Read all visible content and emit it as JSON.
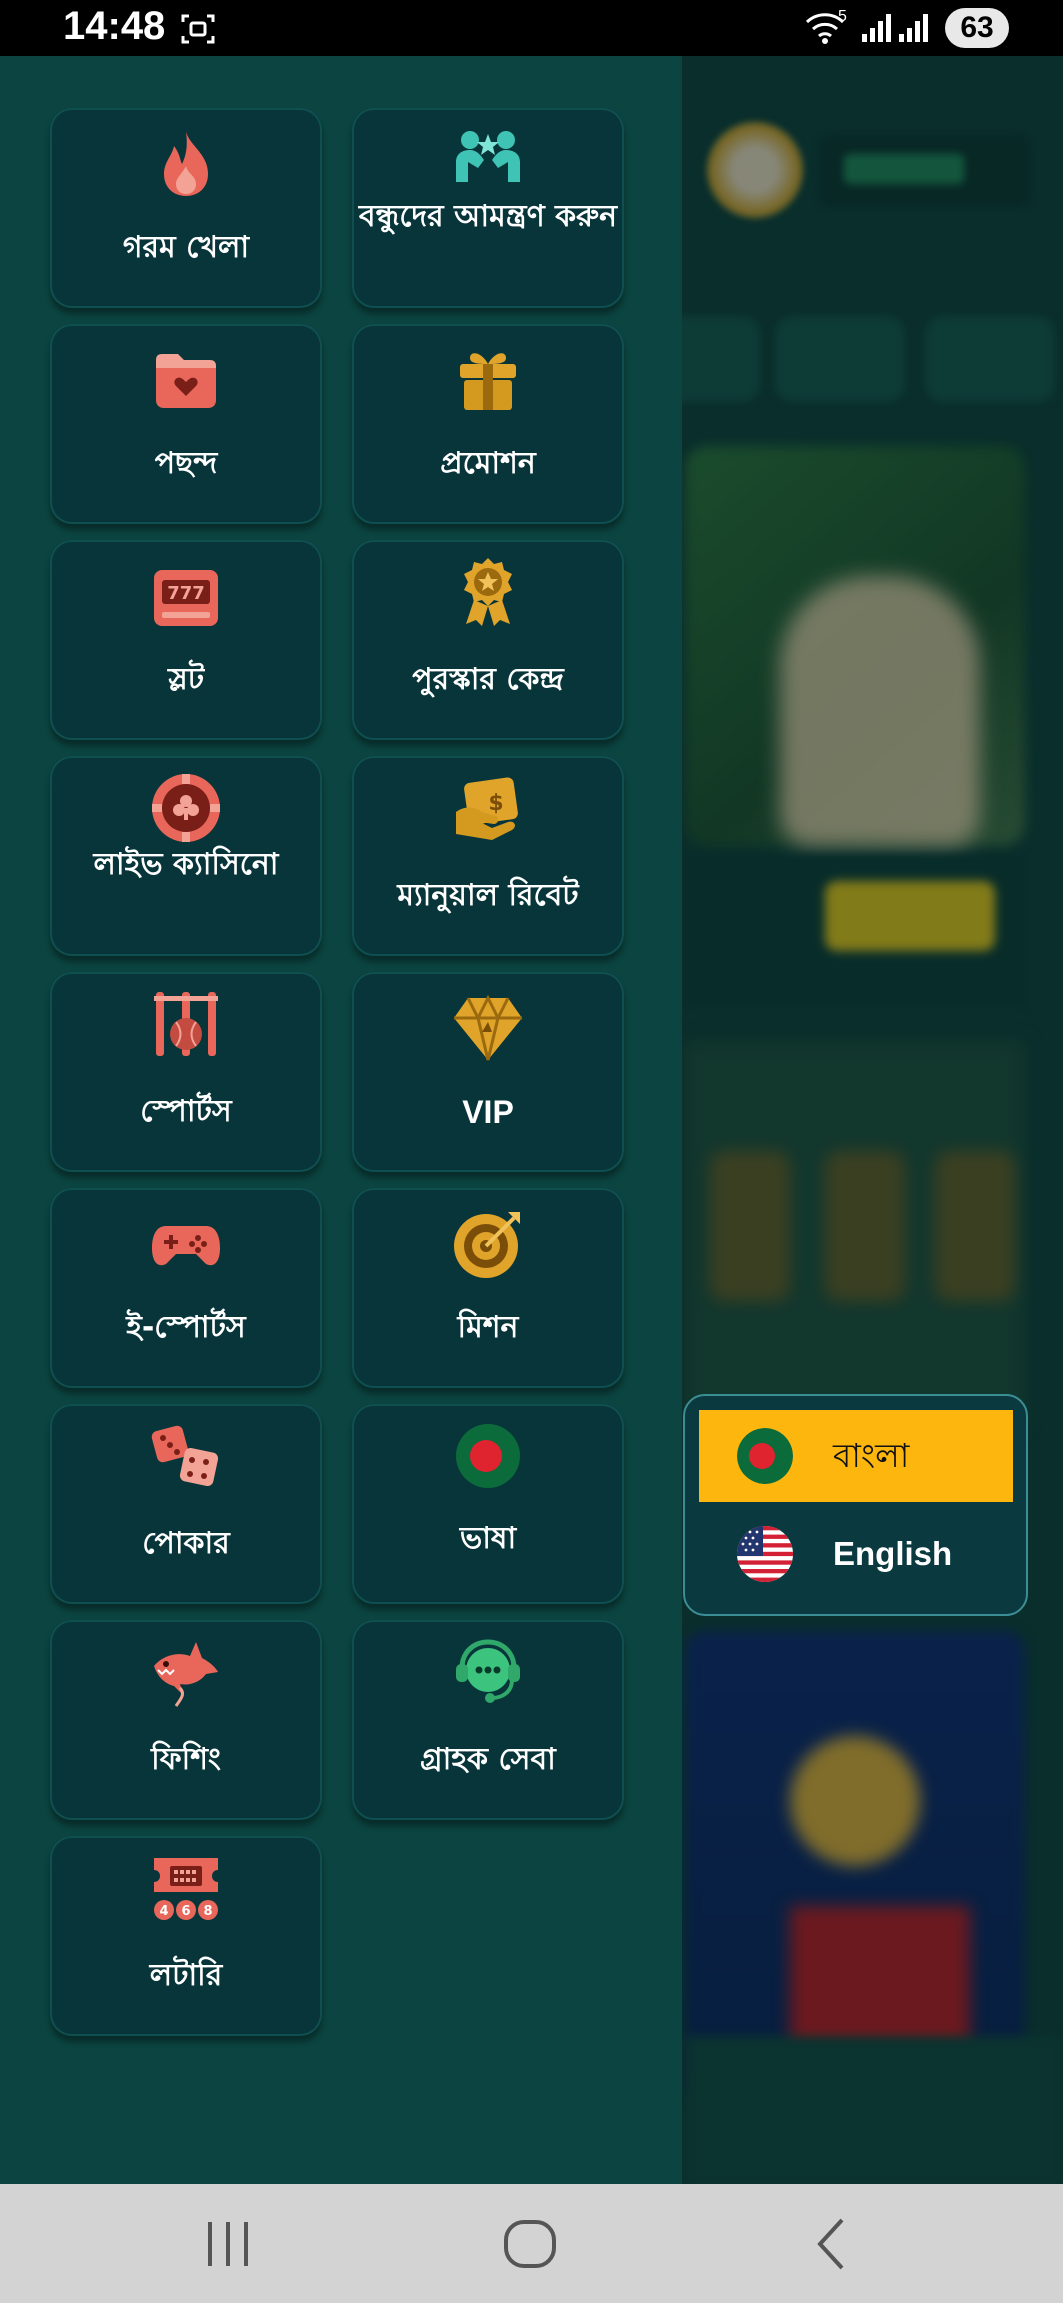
{
  "status_bar": {
    "time": "14:48",
    "wifi_label": "5",
    "battery": "63"
  },
  "menu": {
    "items": [
      {
        "label": "গরম খেলা",
        "icon": "fire-icon"
      },
      {
        "label": "বন্ধুদের আমন্ত্রণ করুন",
        "icon": "invite-friends-icon"
      },
      {
        "label": "পছন্দ",
        "icon": "favorite-folder-icon"
      },
      {
        "label": "প্রমোশন",
        "icon": "gift-icon"
      },
      {
        "label": "স্লট",
        "icon": "slot-machine-icon"
      },
      {
        "label": "পুরস্কার কেন্দ্র",
        "icon": "medal-icon"
      },
      {
        "label": "লাইভ ক্যাসিনো",
        "icon": "casino-chip-icon"
      },
      {
        "label": "ম্যানুয়াল রিবেট",
        "icon": "rebate-hand-icon"
      },
      {
        "label": "স্পোর্টস",
        "icon": "cricket-icon"
      },
      {
        "label": "VIP",
        "icon": "diamond-icon"
      },
      {
        "label": "ই-স্পোর্টস",
        "icon": "gamepad-icon"
      },
      {
        "label": "মিশন",
        "icon": "target-icon"
      },
      {
        "label": "পোকার",
        "icon": "dice-icon"
      },
      {
        "label": "ভাষা",
        "icon": "bangladesh-flag-icon"
      },
      {
        "label": "ফিশিং",
        "icon": "shark-icon"
      },
      {
        "label": "গ্রাহক সেবা",
        "icon": "customer-service-icon"
      },
      {
        "label": "লটারি",
        "icon": "lottery-ticket-icon"
      }
    ]
  },
  "language_popover": {
    "options": [
      {
        "label": "বাংলা",
        "selected": true,
        "flag": "bangladesh-flag-icon"
      },
      {
        "label": "English",
        "selected": false,
        "flag": "usa-flag-icon"
      }
    ]
  },
  "colors": {
    "drawer_bg": "#0b4440",
    "tile_bg": "#07353a",
    "icon_coral": "#e8675a",
    "icon_gold": "#e0a42a",
    "icon_teal": "#3fc3b4",
    "selected_language_bg": "#fdb60d"
  }
}
